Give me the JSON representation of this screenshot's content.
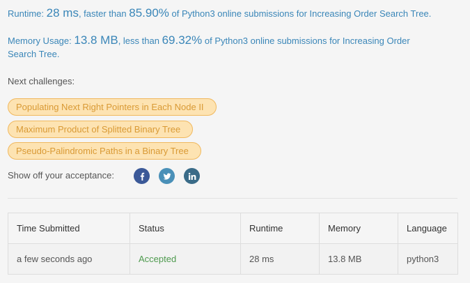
{
  "runtime": {
    "label": "Runtime:",
    "value": "28 ms",
    "comparison": ", faster than",
    "percent": "85.90%",
    "suffix": "of Python3 online submissions for Increasing Order Search Tree."
  },
  "memory": {
    "label": "Memory Usage:",
    "value": "13.8 MB",
    "comparison": ", less than",
    "percent": "69.32%",
    "suffix": "of Python3 online submissions for Increasing Order Search Tree."
  },
  "next_challenges": {
    "label": "Next challenges:",
    "items": [
      "Populating Next Right Pointers in Each Node II",
      "Maximum Product of Splitted Binary Tree",
      "Pseudo-Palindromic Paths in a Binary Tree"
    ]
  },
  "share": {
    "label": "Show off your acceptance:",
    "icons": [
      "facebook-icon",
      "twitter-icon",
      "linkedin-icon"
    ]
  },
  "submissions": {
    "columns": [
      "Time Submitted",
      "Status",
      "Runtime",
      "Memory",
      "Language"
    ],
    "rows": [
      {
        "time": "a few seconds ago",
        "status": "Accepted",
        "runtime": "28 ms",
        "memory": "13.8 MB",
        "language": "python3"
      }
    ]
  },
  "colors": {
    "accent_blue": "#3a86b8",
    "chip_background": "#fde3b2",
    "chip_text": "#d99a35",
    "accepted_green": "#4e9a4e"
  }
}
